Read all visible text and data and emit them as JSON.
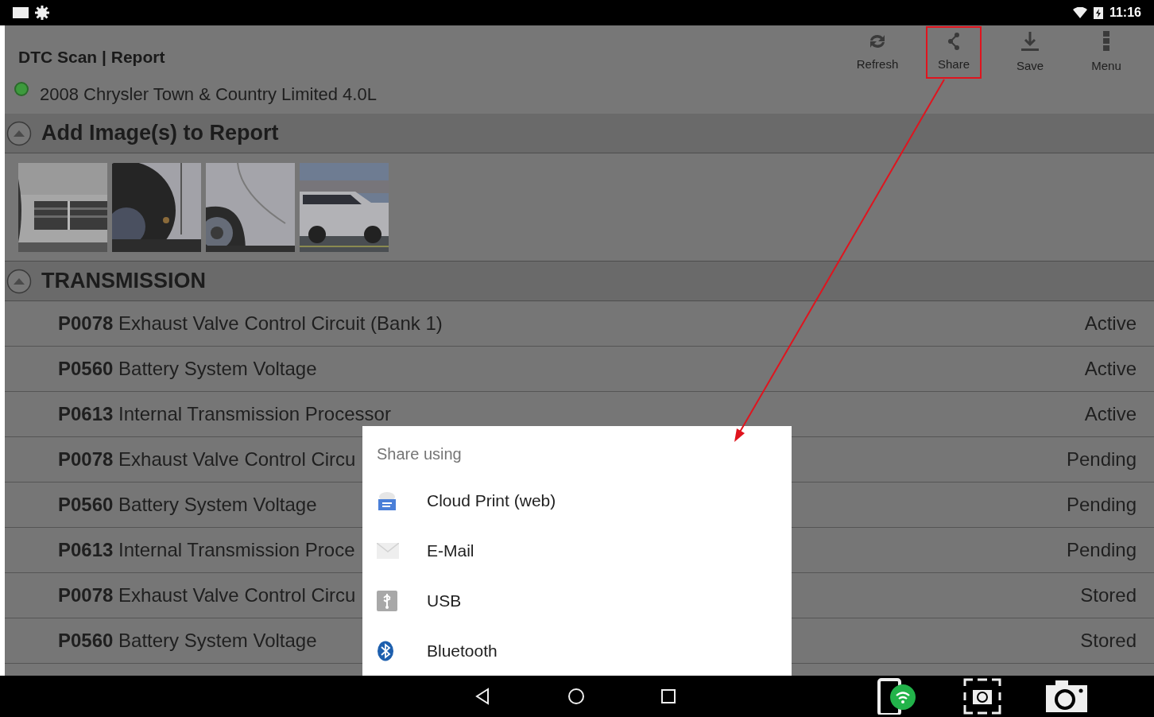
{
  "status_bar": {
    "time": "11:16"
  },
  "header": {
    "title": "DTC Scan | Report",
    "vehicle": "2008 Chrysler Town & Country Limited 4.0L",
    "connected": true
  },
  "toolbar": [
    {
      "label": "Refresh",
      "kind": "refresh",
      "highlighted": false
    },
    {
      "label": "Share",
      "kind": "share",
      "highlighted": true
    },
    {
      "label": "Save",
      "kind": "save",
      "highlighted": false
    },
    {
      "label": "Menu",
      "kind": "menu",
      "highlighted": false
    }
  ],
  "images_section": {
    "title": "Add Image(s) to Report",
    "expanded": true
  },
  "transmission_section": {
    "title": "TRANSMISSION",
    "expanded": true,
    "rows": [
      {
        "code": "P0078",
        "description": "Exhaust Valve Control Circuit (Bank 1)",
        "status": "Active"
      },
      {
        "code": "P0560",
        "description": "Battery System Voltage",
        "status": "Active"
      },
      {
        "code": "P0613",
        "description": "Internal Transmission Processor",
        "status": "Active"
      },
      {
        "code": "P0078",
        "description": "Exhaust Valve Control Circu",
        "status": "Pending"
      },
      {
        "code": "P0560",
        "description": "Battery System Voltage",
        "status": "Pending"
      },
      {
        "code": "P0613",
        "description": "Internal Transmission Proce",
        "status": "Pending"
      },
      {
        "code": "P0078",
        "description": "Exhaust Valve Control Circu",
        "status": "Stored"
      },
      {
        "code": "P0560",
        "description": "Battery System Voltage",
        "status": "Stored"
      }
    ]
  },
  "share_dialog": {
    "title": "Share using",
    "options": [
      {
        "label": "Cloud Print (web)",
        "kind": "cloud-print"
      },
      {
        "label": "E-Mail",
        "kind": "email"
      },
      {
        "label": "USB",
        "kind": "usb"
      },
      {
        "label": "Bluetooth",
        "kind": "bluetooth"
      }
    ]
  }
}
